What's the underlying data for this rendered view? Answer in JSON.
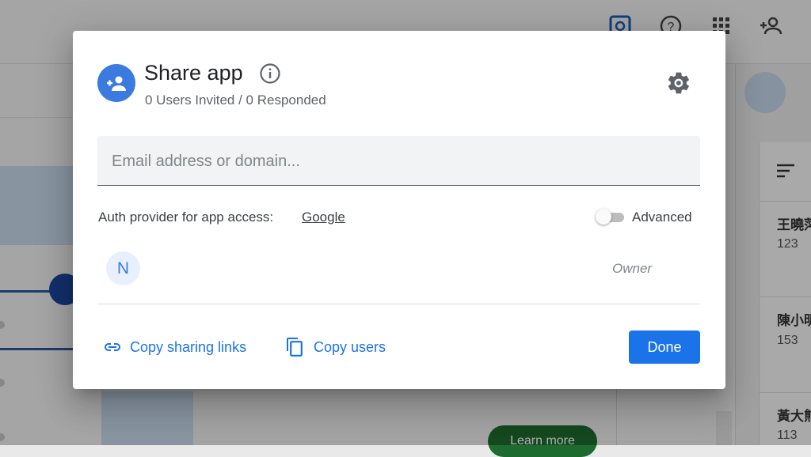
{
  "background": {
    "green_button_label": "Learn more",
    "cards": [
      {
        "name": "王曉萍",
        "number": "123"
      },
      {
        "name": "陳小明",
        "number": "153"
      },
      {
        "name": "黃大熊",
        "number": "113"
      }
    ]
  },
  "dialog": {
    "title": "Share app",
    "subtitle": "0 Users Invited / 0 Responded",
    "email_placeholder": "Email address or domain...",
    "auth_label": "Auth provider for app access:",
    "auth_provider": "Google",
    "advanced_label": "Advanced",
    "advanced_enabled": false,
    "users": [
      {
        "initial": "N",
        "role": "Owner"
      }
    ],
    "actions": {
      "copy_links": "Copy sharing links",
      "copy_users": "Copy users",
      "done": "Done"
    }
  },
  "colors": {
    "accent": "#1a73e8",
    "avatar_bg": "#3b7be0",
    "overlay": "rgba(0,0,0,0.32)"
  },
  "icons": [
    "add-person-icon",
    "info-icon",
    "gear-icon",
    "link-icon",
    "copy-icon",
    "help-icon",
    "grid-icon",
    "phone-icon",
    "sort-icon",
    "pencil-icon"
  ]
}
